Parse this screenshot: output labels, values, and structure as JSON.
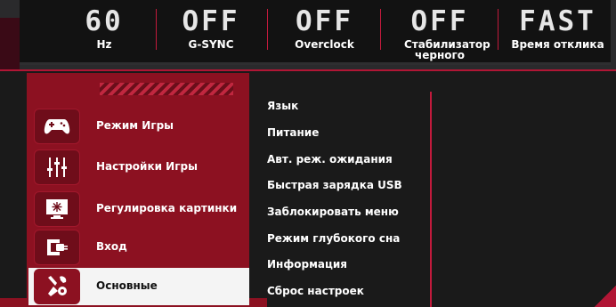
{
  "status": [
    {
      "value": "60",
      "label": "Hz"
    },
    {
      "value": "OFF",
      "label": "G-SYNC"
    },
    {
      "value": "OFF",
      "label": "Overclock"
    },
    {
      "value": "OFF",
      "label": "Стабилизатор черного"
    },
    {
      "value": "FAST",
      "label": "Время отклика"
    }
  ],
  "nav": [
    {
      "label": "Режим Игры",
      "icon": "gamepad-icon",
      "active": false
    },
    {
      "label": "Настройки Игры",
      "icon": "sliders-icon",
      "active": false
    },
    {
      "label": "Регулировка картинки",
      "icon": "display-icon",
      "active": false
    },
    {
      "label": "Вход",
      "icon": "input-icon",
      "active": false
    },
    {
      "label": "Основные",
      "icon": "tools-icon",
      "active": true
    }
  ],
  "menu": [
    "Язык",
    "Питание",
    "Авт. реж. ожидания",
    "Быстрая зарядка USB",
    "Заблокировать меню",
    "Режим глубокого сна",
    "Информация",
    "Сброс настроек"
  ],
  "colors": {
    "accent": "#c21a3c",
    "panel": "#8c1121",
    "background": "#1a1a1a"
  }
}
